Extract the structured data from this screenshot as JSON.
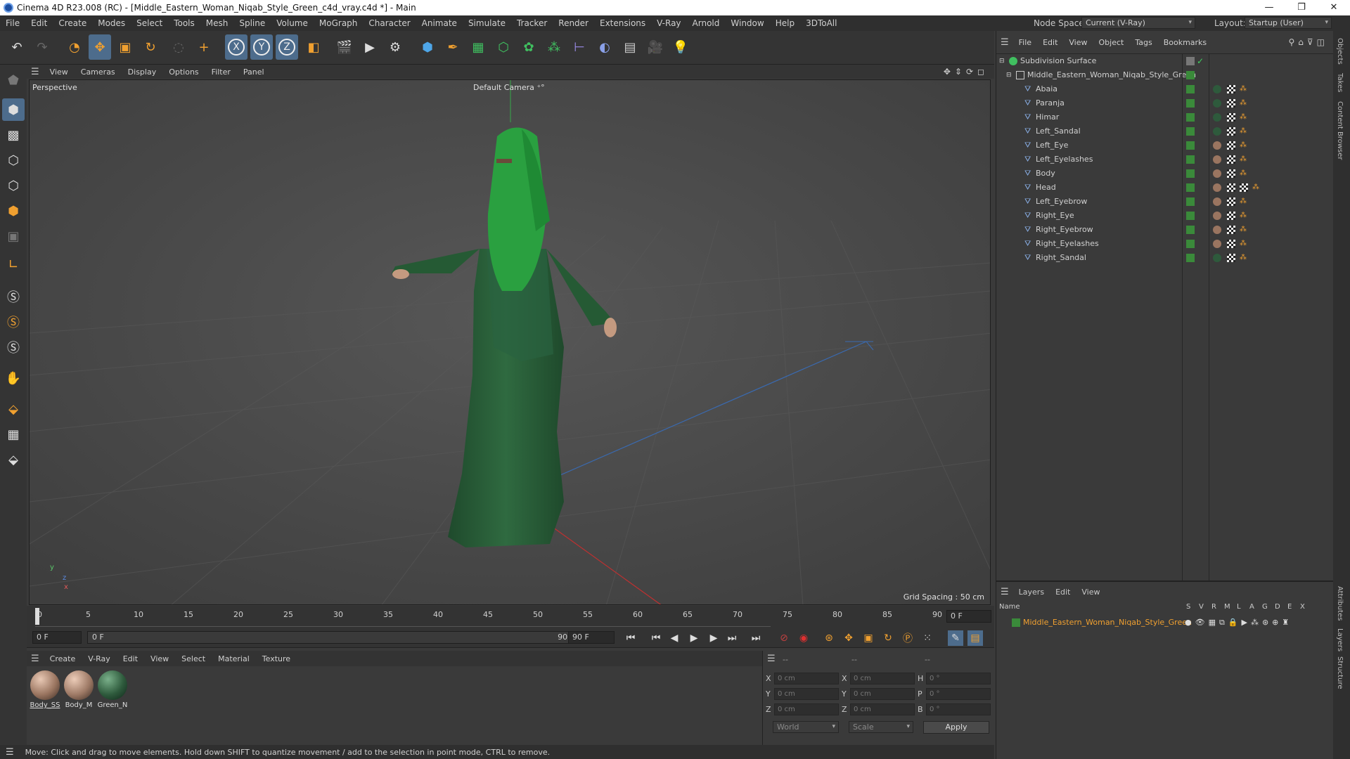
{
  "window": {
    "title": "Cinema 4D R23.008 (RC) - [Middle_Eastern_Woman_Niqab_Style_Green_c4d_vray.c4d *] - Main",
    "controls": [
      "—",
      "❐",
      "✕"
    ]
  },
  "menubar": {
    "items": [
      "File",
      "Edit",
      "Create",
      "Modes",
      "Select",
      "Tools",
      "Mesh",
      "Spline",
      "Volume",
      "MoGraph",
      "Character",
      "Animate",
      "Simulate",
      "Tracker",
      "Render",
      "Extensions",
      "V-Ray",
      "Arnold",
      "Window",
      "Help",
      "3DToAll"
    ],
    "node_space_label": "Node Space:",
    "node_space_value": "Current (V-Ray)",
    "layout_label": "Layout:",
    "layout_value": "Startup (User)"
  },
  "toolbar": {
    "axis_x": "X",
    "axis_y": "Y",
    "axis_z": "Z"
  },
  "viewport": {
    "menu": [
      "View",
      "Cameras",
      "Display",
      "Options",
      "Filter",
      "Panel"
    ],
    "label": "Perspective",
    "camera": "Default Camera",
    "grid_spacing": "Grid Spacing : 50 cm",
    "axis_y": "y",
    "axis_z": "z",
    "axis_x": "x"
  },
  "timeline": {
    "ticks": [
      "0",
      "5",
      "10",
      "15",
      "20",
      "25",
      "30",
      "35",
      "40",
      "45",
      "50",
      "55",
      "60",
      "65",
      "70",
      "75",
      "80",
      "85",
      "90"
    ],
    "current_frame": "0 F",
    "start_field": "0 F",
    "range_start": "0 F",
    "range_end": "90 F",
    "end_field": "90 F"
  },
  "materials": {
    "menu": [
      "Create",
      "V-Ray",
      "Edit",
      "View",
      "Select",
      "Material",
      "Texture"
    ],
    "items": [
      {
        "name": "Body_SS",
        "color": "#9a7560"
      },
      {
        "name": "Body_M",
        "color": "#9e7a66"
      },
      {
        "name": "Green_N",
        "color": "#2e5a3c"
      }
    ]
  },
  "coordinates": {
    "header": [
      "--",
      "--",
      "--"
    ],
    "rows": [
      {
        "a": "X",
        "av": "0 cm",
        "b": "X",
        "bv": "0 cm",
        "c": "H",
        "cv": "0 °"
      },
      {
        "a": "Y",
        "av": "0 cm",
        "b": "Y",
        "bv": "0 cm",
        "c": "P",
        "cv": "0 °"
      },
      {
        "a": "Z",
        "av": "0 cm",
        "b": "Z",
        "bv": "0 cm",
        "c": "B",
        "cv": "0 °"
      }
    ],
    "space": "World",
    "mode": "Scale",
    "apply": "Apply"
  },
  "status": "Move: Click and drag to move elements. Hold down SHIFT to quantize movement / add to the selection in point mode, CTRL to remove.",
  "objects": {
    "menu": [
      "File",
      "Edit",
      "View",
      "Object",
      "Tags",
      "Bookmarks"
    ],
    "root": "Subdivision Surface",
    "group": "Middle_Eastern_Woman_Niqab_Style_Green",
    "children": [
      {
        "name": "Abaia",
        "mat": "#2e5a3c"
      },
      {
        "name": "Paranja",
        "mat": "#2e5a3c"
      },
      {
        "name": "Himar",
        "mat": "#2e5a3c"
      },
      {
        "name": "Left_Sandal",
        "mat": "#2e5a3c"
      },
      {
        "name": "Left_Eye",
        "mat": "#9a7560"
      },
      {
        "name": "Left_Eyelashes",
        "mat": "#9a7560"
      },
      {
        "name": "Body",
        "mat": "#9a7560"
      },
      {
        "name": "Head",
        "mat": "#9a7560"
      },
      {
        "name": "Left_Eyebrow",
        "mat": "#9a7560"
      },
      {
        "name": "Right_Eye",
        "mat": "#9a7560"
      },
      {
        "name": "Right_Eyebrow",
        "mat": "#9a7560"
      },
      {
        "name": "Right_Eyelashes",
        "mat": "#9a7560"
      },
      {
        "name": "Right_Sandal",
        "mat": "#2e5a3c"
      }
    ]
  },
  "layers": {
    "menu": [
      "Layers",
      "Edit",
      "View"
    ],
    "name_header": "Name",
    "cols": [
      "S",
      "V",
      "R",
      "M",
      "L",
      "A",
      "G",
      "D",
      "E",
      "X"
    ],
    "layer": "Middle_Eastern_Woman_Niqab_Style_Green"
  },
  "side_tabs": [
    "Objects",
    "Takes",
    "Content Browser",
    "Attributes",
    "Layers",
    "Structure"
  ]
}
